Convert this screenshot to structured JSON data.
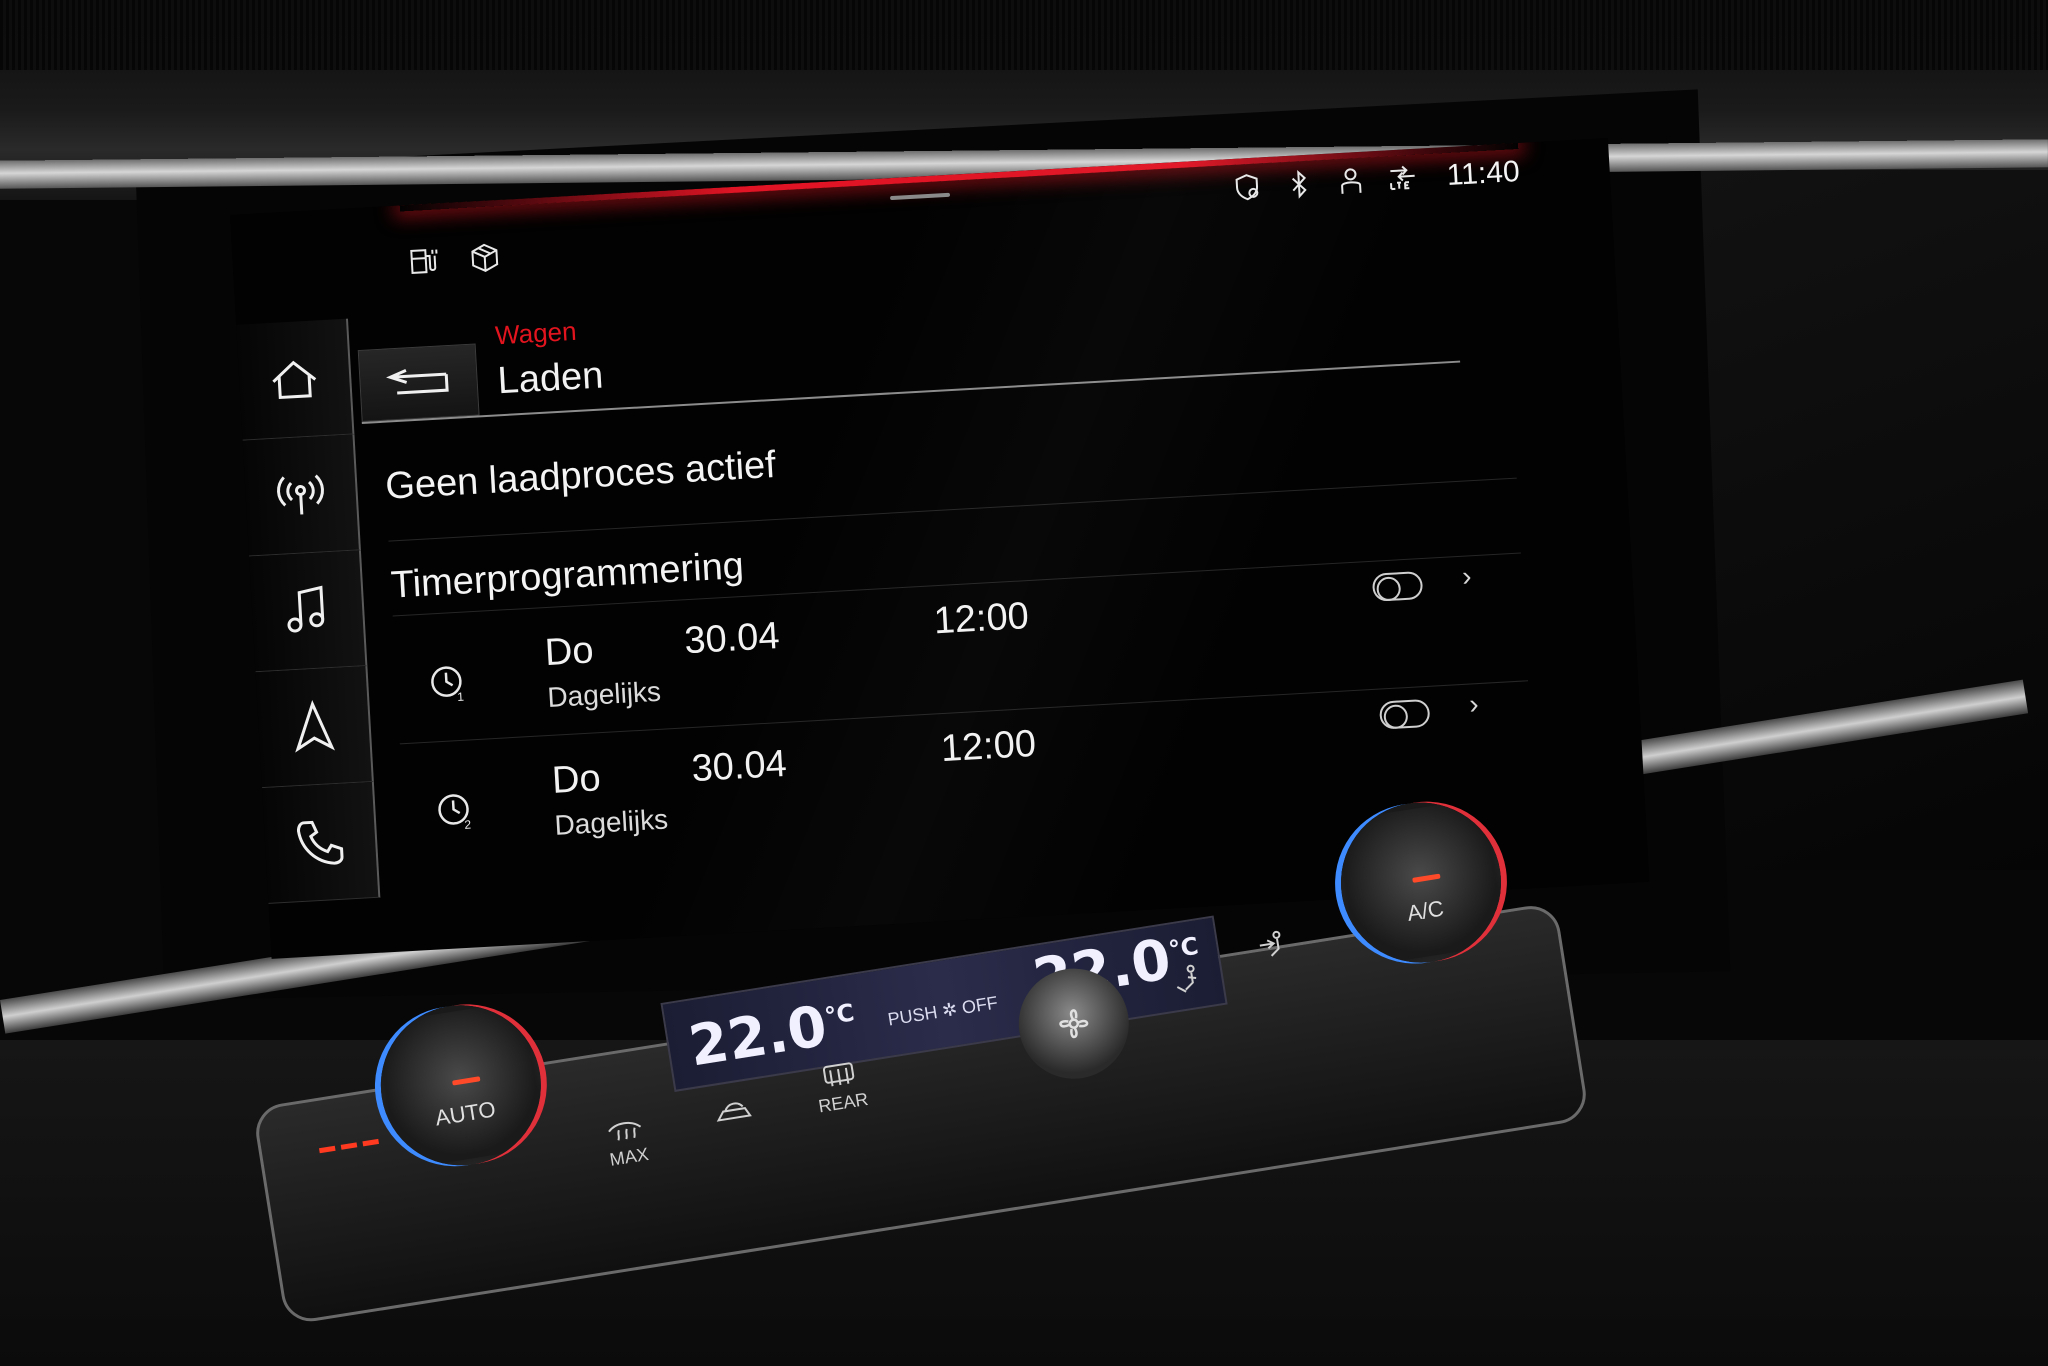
{
  "status_bar": {
    "time": "11:40",
    "icons": [
      "privacy-shield-icon",
      "bluetooth-icon",
      "user-profile-icon",
      "lte-signal-icon"
    ]
  },
  "quick_icons": [
    "charging-station-icon",
    "package-icon"
  ],
  "nav_rail": [
    {
      "name": "home",
      "icon": "home-icon"
    },
    {
      "name": "radio",
      "icon": "radio-antenna-icon"
    },
    {
      "name": "media",
      "icon": "music-note-icon"
    },
    {
      "name": "navigation",
      "icon": "navigation-arrow-icon"
    },
    {
      "name": "phone",
      "icon": "phone-icon"
    }
  ],
  "header": {
    "breadcrumb": "Wagen",
    "title": "Laden"
  },
  "content": {
    "charge_status": "Geen laadproces actief",
    "section_title": "Timerprogrammering",
    "timers": [
      {
        "day": "Do",
        "date": "30.04",
        "time": "12:00",
        "repeat": "Dagelijks",
        "icon": "timer-1-icon",
        "enabled": false
      },
      {
        "day": "Do",
        "date": "30.04",
        "time": "12:00",
        "repeat": "Dagelijks",
        "icon": "timer-2-icon",
        "enabled": false
      }
    ]
  },
  "climate": {
    "temp_left": "22.0",
    "temp_right": "22.0",
    "temp_unit": "°C",
    "push_off_left": "PUSH",
    "push_off_right": "OFF",
    "auto_label": "AUTO",
    "ac_label": "A/C",
    "max_label": "MAX",
    "rear_label": "REAR"
  },
  "colors": {
    "accent_red": "#e2141e",
    "text": "#f2f2f2",
    "background": "#020202"
  }
}
